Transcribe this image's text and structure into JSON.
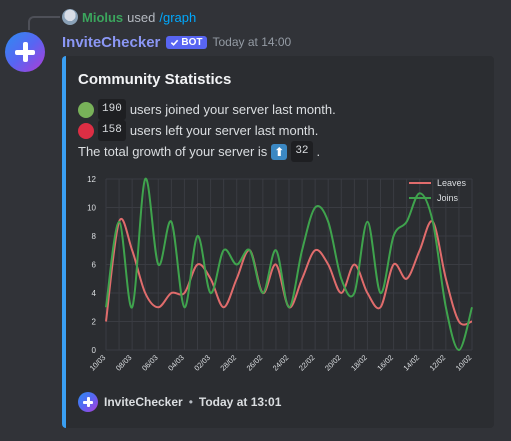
{
  "reply": {
    "username": "Miolus",
    "used_text": "used",
    "command": "/graph"
  },
  "message": {
    "author": "InviteChecker",
    "bot_tag": "BOT",
    "timestamp": "Today at 14:00"
  },
  "embed": {
    "accent_color": "#3a9ff2",
    "title": "Community Statistics",
    "joined_count": "190",
    "joined_text": "users joined your server last month.",
    "left_count": "158",
    "left_text": "users left your server last month.",
    "growth_text": "The total growth of your server is",
    "growth_icon": "up-arrow-icon",
    "growth_value": "32",
    "growth_suffix": ".",
    "footer_author": "InviteChecker",
    "footer_separator": "•",
    "footer_timestamp": "Today at 13:01"
  },
  "chart_data": {
    "type": "line",
    "ylim": [
      0,
      12
    ],
    "yticks": [
      0,
      2,
      4,
      6,
      8,
      10,
      12
    ],
    "grid": true,
    "legend_position": "top-right",
    "x": [
      "10/03",
      "09/03",
      "08/03",
      "07/03",
      "06/03",
      "05/03",
      "04/03",
      "03/03",
      "02/03",
      "01/03",
      "28/02",
      "27/02",
      "26/02",
      "25/02",
      "24/02",
      "23/02",
      "22/02",
      "21/02",
      "20/02",
      "19/02",
      "18/02",
      "17/02",
      "16/02",
      "15/02",
      "14/02",
      "13/02",
      "12/02",
      "11/02",
      "10/02"
    ],
    "x_tick_labels": [
      "10/03",
      "08/03",
      "06/03",
      "04/03",
      "02/03",
      "28/02",
      "26/02",
      "24/02",
      "22/02",
      "20/02",
      "18/02",
      "16/02",
      "14/02",
      "12/02",
      "10/02"
    ],
    "series": [
      {
        "name": "Leaves",
        "color": "#e06c6c",
        "values": [
          2,
          9,
          7,
          4,
          3,
          4,
          4,
          6,
          5,
          3,
          5,
          7,
          4,
          6,
          3,
          5,
          7,
          6,
          4,
          6,
          4,
          3,
          6,
          5,
          7,
          9,
          5,
          2,
          2
        ]
      },
      {
        "name": "Joins",
        "color": "#3fa34d",
        "values": [
          3,
          9,
          3,
          12,
          6,
          9,
          3,
          8,
          4,
          7,
          6,
          7,
          4,
          7,
          3,
          7,
          10,
          9,
          5,
          4,
          9,
          4,
          8,
          9,
          11,
          9,
          3,
          0,
          3
        ]
      }
    ]
  }
}
